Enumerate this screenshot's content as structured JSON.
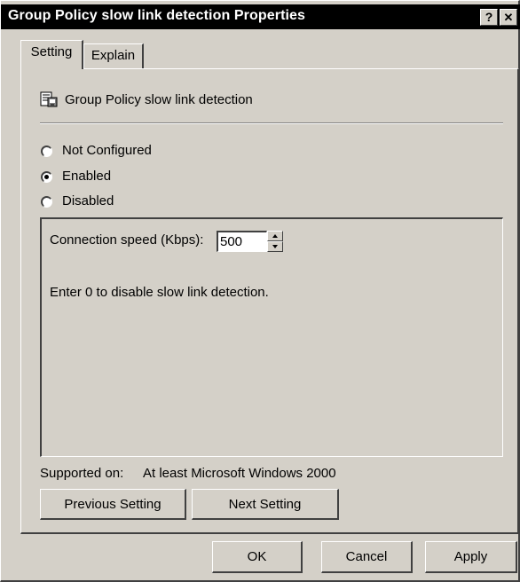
{
  "window": {
    "title": "Group Policy slow link detection Properties",
    "help_glyph": "?",
    "close_glyph": "✕"
  },
  "tabs": [
    {
      "label": "Setting",
      "active": true
    },
    {
      "label": "Explain",
      "active": false
    }
  ],
  "policy": {
    "icon": "policy-setting-icon",
    "name": "Group Policy slow link detection"
  },
  "radio_options": [
    {
      "label": "Not Configured",
      "checked": false
    },
    {
      "label": "Enabled",
      "checked": true
    },
    {
      "label": "Disabled",
      "checked": false
    }
  ],
  "options": {
    "speed_label": "Connection speed (Kbps):",
    "speed_value": "500",
    "hint": "Enter 0 to disable slow link detection."
  },
  "supported": {
    "label": "Supported on:",
    "value": "At least Microsoft Windows 2000"
  },
  "nav_buttons": {
    "previous": "Previous Setting",
    "next": "Next Setting"
  },
  "dialog_buttons": {
    "ok": "OK",
    "cancel": "Cancel",
    "apply": "Apply"
  },
  "colors": {
    "face": "#d4d0c8",
    "titlebar": "#000000",
    "title_text": "#ffffff"
  }
}
